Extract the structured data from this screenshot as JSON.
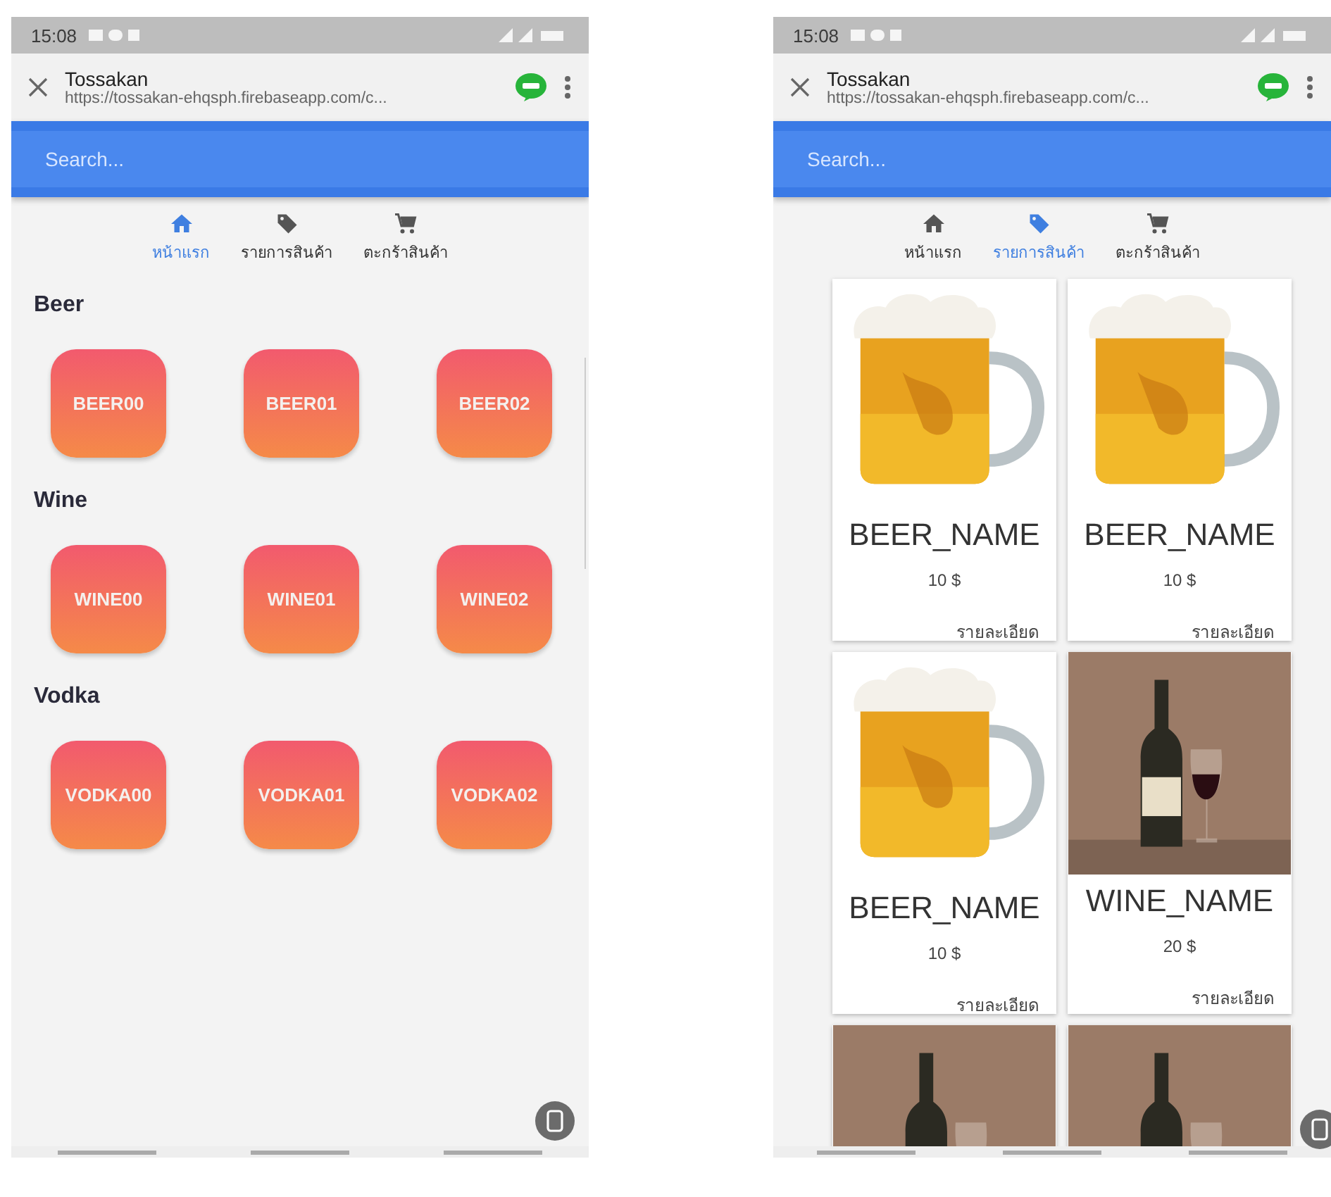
{
  "screens": [
    {
      "status_bar": {
        "time": "15:08"
      },
      "browser_bar": {
        "title": "Tossakan",
        "url": "https://tossakan-ehqsph.firebaseapp.com/c..."
      },
      "search": {
        "placeholder": "Search..."
      },
      "tabs": [
        {
          "label": "หน้าแรก",
          "selected": true
        },
        {
          "label": "รายการสินค้า",
          "selected": false
        },
        {
          "label": "ตะกร้าสินค้า",
          "selected": false
        }
      ],
      "content": {
        "kind": "categories",
        "sections": [
          {
            "title": "Beer",
            "items": [
              "BEER00",
              "BEER01",
              "BEER02"
            ]
          },
          {
            "title": "Wine",
            "items": [
              "WINE00",
              "WINE01",
              "WINE02"
            ]
          },
          {
            "title": "Vodka",
            "items": [
              "VODKA00",
              "VODKA01",
              "VODKA02"
            ]
          }
        ]
      }
    },
    {
      "status_bar": {
        "time": "15:08"
      },
      "browser_bar": {
        "title": "Tossakan",
        "url": "https://tossakan-ehqsph.firebaseapp.com/c..."
      },
      "search": {
        "placeholder": "Search..."
      },
      "tabs": [
        {
          "label": "หน้าแรก",
          "selected": false
        },
        {
          "label": "รายการสินค้า",
          "selected": true
        },
        {
          "label": "ตะกร้าสินค้า",
          "selected": false
        }
      ],
      "content": {
        "kind": "products",
        "products": [
          {
            "kind": "beer",
            "name": "BEER_NAME",
            "price": "10 $",
            "link": "รายละเอียด"
          },
          {
            "kind": "beer",
            "name": "BEER_NAME",
            "price": "10 $",
            "link": "รายละเอียด"
          },
          {
            "kind": "beer",
            "name": "BEER_NAME",
            "price": "10 $",
            "link": "รายละเอียด"
          },
          {
            "kind": "wine",
            "name": "WINE_NAME",
            "price": "20 $",
            "link": "รายละเอียด"
          },
          {
            "kind": "wine"
          },
          {
            "kind": "wine"
          }
        ]
      }
    }
  ]
}
